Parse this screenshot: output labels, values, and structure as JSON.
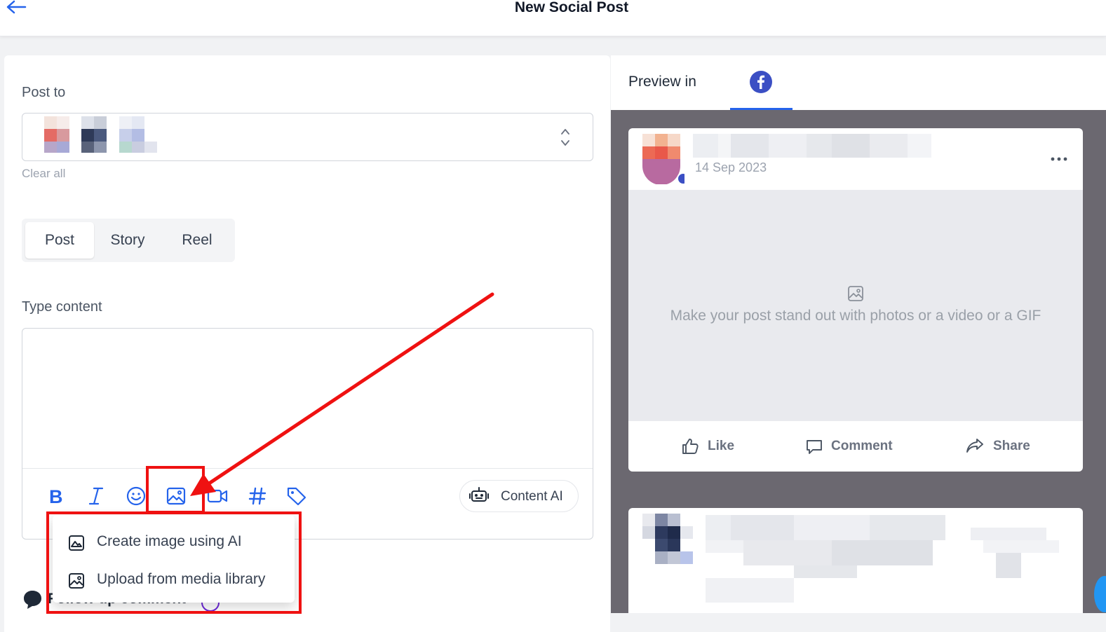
{
  "header": {
    "title": "New Social Post"
  },
  "post_to": {
    "label": "Post to",
    "clear_all": "Clear all"
  },
  "post_types": [
    {
      "label": "Post",
      "active": true
    },
    {
      "label": "Story",
      "active": false
    },
    {
      "label": "Reel",
      "active": false
    }
  ],
  "content": {
    "label": "Type content",
    "value": "",
    "content_ai_label": "Content AI"
  },
  "toolbar_icons": [
    "bold-icon",
    "italic-icon",
    "emoji-icon",
    "image-icon",
    "video-icon",
    "hashtag-icon",
    "tag-icon"
  ],
  "image_menu": {
    "items": [
      {
        "label": "Create image using AI",
        "icon": "image-ai-icon"
      },
      {
        "label": "Upload from media library",
        "icon": "image-library-icon"
      }
    ]
  },
  "follow_up": {
    "label": "Follow up comment"
  },
  "preview": {
    "label": "Preview in",
    "network": "facebook",
    "post_date": "14 Sep 2023",
    "media_placeholder": "Make your post stand out with photos or a video or a GIF",
    "actions": {
      "like": "Like",
      "comment": "Comment",
      "share": "Share"
    }
  },
  "colors": {
    "accent": "#2563eb",
    "annotation": "#ef1111",
    "preview_bg": "#6b6870",
    "facebook": "#3b4fc4"
  }
}
